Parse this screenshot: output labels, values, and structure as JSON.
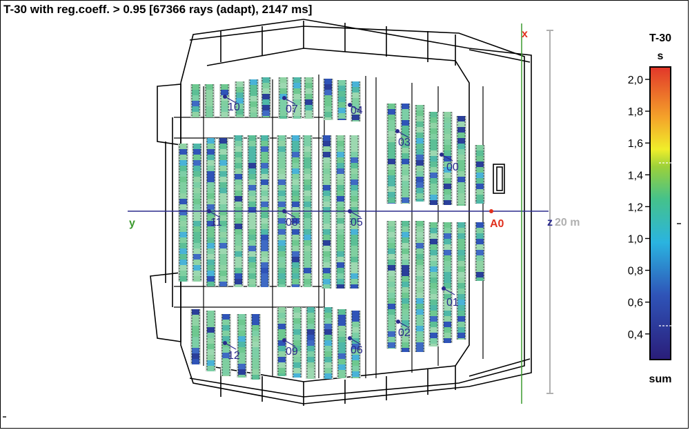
{
  "title": "T-30 with reg.coeff. > 0.95 [67366 rays (adapt), 2147 ms]",
  "axes": {
    "x_label": "x",
    "y_label": "y",
    "z_label": "z",
    "scale_label": "20 m"
  },
  "origin_label": "A0",
  "receivers": [
    "10",
    "07",
    "04",
    "03",
    "00",
    "11",
    "08",
    "05",
    "01",
    "02",
    "12",
    "09",
    "06"
  ],
  "colorbar": {
    "title": "T-30",
    "unit": "s",
    "ticks": [
      "2,0",
      "1,8",
      "1,6",
      "1,4",
      "1,2",
      "1,0",
      "0,8",
      "0,6",
      "0,4"
    ],
    "range": [
      0.25,
      2.05
    ],
    "footer": "sum"
  },
  "colors": {
    "axis_x": "#3c9a2e",
    "axis_z": "#2a2a8c",
    "origin": "#e0301e",
    "receiver": "#2a2a8c",
    "scale": "#b0b0b0"
  }
}
